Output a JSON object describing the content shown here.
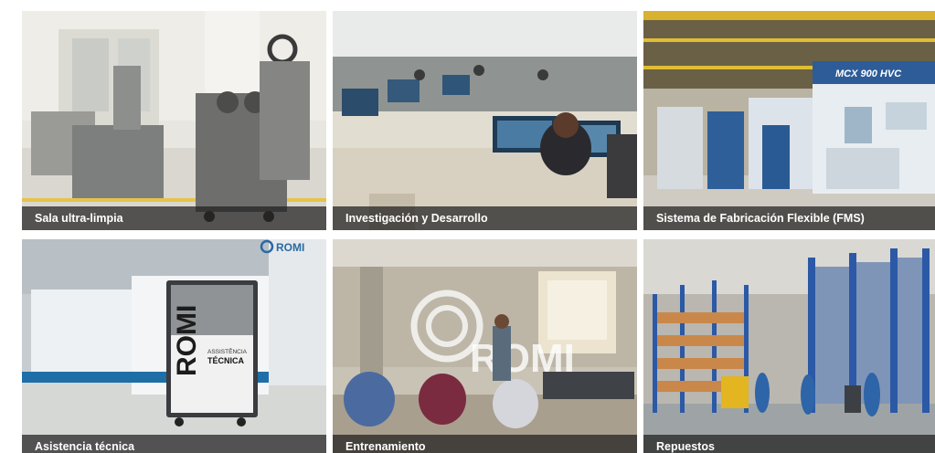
{
  "tiles": [
    {
      "caption": "Sala ultra-limpia"
    },
    {
      "caption": "Investigación y Desarrollo"
    },
    {
      "caption": "Sistema de Fabricación Flexible (FMS)"
    },
    {
      "caption": "Asistencia técnica"
    },
    {
      "caption": "Entrenamiento"
    },
    {
      "caption": "Repuestos"
    }
  ],
  "photo_text": {
    "machine_label": "MCX 900 HVC",
    "banner_brand": "ROMI",
    "sign_brand": "ROMI",
    "sign_line1": "ASSISTÊNCIA",
    "sign_line2": "TÉCNICA",
    "wall_brand": "ROMI"
  }
}
